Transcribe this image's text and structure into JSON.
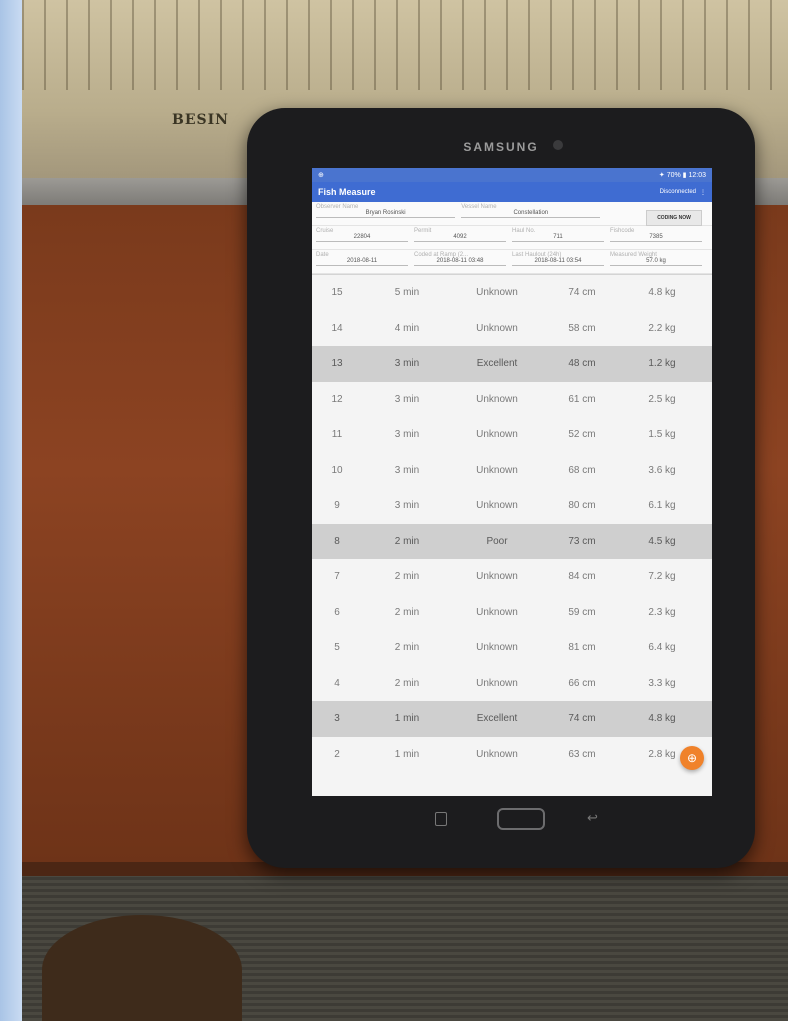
{
  "device": {
    "brand": "SAMSUNG",
    "board_logo": "BESIN"
  },
  "status_bar": {
    "left": "⊕",
    "right": "✦ 70% ▮ 12:03"
  },
  "app_bar": {
    "title": "Fish Measure",
    "button_label": "Disconnected",
    "menu_icon": "overflow-menu-icon"
  },
  "info": {
    "observer_name": {
      "label": "Observer Name",
      "value": "Bryan Rosinski"
    },
    "vessel_name": {
      "label": "Vessel Name",
      "value": "Constellation"
    },
    "coding_button": "CODING NOW",
    "cruise": {
      "label": "Cruise",
      "value": "22804"
    },
    "permit": {
      "label": "Permit",
      "value": "4092"
    },
    "haul_no": {
      "label": "Haul No.",
      "value": "711"
    },
    "fishcode": {
      "label": "Fishcode",
      "value": "7385"
    },
    "date": {
      "label": "Date",
      "value": "2018-08-11"
    },
    "coded_at_ramp": {
      "label": "Coded at Ramp (2...",
      "value": "2018-08-11 03:48"
    },
    "last_haulout": {
      "label": "Last Haulout (24h)",
      "value": "2018-08-11 03:54"
    },
    "measured_weight": {
      "label": "Measured Weight",
      "value": "57.0 kg"
    }
  },
  "rows": [
    {
      "n": "15",
      "time": "5 min",
      "quality": "Unknown",
      "length": "74 cm",
      "weight": "4.8 kg",
      "highlight": false
    },
    {
      "n": "14",
      "time": "4 min",
      "quality": "Unknown",
      "length": "58 cm",
      "weight": "2.2 kg",
      "highlight": false
    },
    {
      "n": "13",
      "time": "3 min",
      "quality": "Excellent",
      "length": "48 cm",
      "weight": "1.2 kg",
      "highlight": true
    },
    {
      "n": "12",
      "time": "3 min",
      "quality": "Unknown",
      "length": "61 cm",
      "weight": "2.5 kg",
      "highlight": false
    },
    {
      "n": "11",
      "time": "3 min",
      "quality": "Unknown",
      "length": "52 cm",
      "weight": "1.5 kg",
      "highlight": false
    },
    {
      "n": "10",
      "time": "3 min",
      "quality": "Unknown",
      "length": "68 cm",
      "weight": "3.6 kg",
      "highlight": false
    },
    {
      "n": "9",
      "time": "3 min",
      "quality": "Unknown",
      "length": "80 cm",
      "weight": "6.1 kg",
      "highlight": false
    },
    {
      "n": "8",
      "time": "2 min",
      "quality": "Poor",
      "length": "73 cm",
      "weight": "4.5 kg",
      "highlight": true
    },
    {
      "n": "7",
      "time": "2 min",
      "quality": "Unknown",
      "length": "84 cm",
      "weight": "7.2 kg",
      "highlight": false
    },
    {
      "n": "6",
      "time": "2 min",
      "quality": "Unknown",
      "length": "59 cm",
      "weight": "2.3 kg",
      "highlight": false
    },
    {
      "n": "5",
      "time": "2 min",
      "quality": "Unknown",
      "length": "81 cm",
      "weight": "6.4 kg",
      "highlight": false
    },
    {
      "n": "4",
      "time": "2 min",
      "quality": "Unknown",
      "length": "66 cm",
      "weight": "3.3 kg",
      "highlight": false
    },
    {
      "n": "3",
      "time": "1 min",
      "quality": "Excellent",
      "length": "74 cm",
      "weight": "4.8 kg",
      "highlight": true
    },
    {
      "n": "2",
      "time": "1 min",
      "quality": "Unknown",
      "length": "63 cm",
      "weight": "2.8 kg",
      "highlight": false
    }
  ],
  "fab_icon": "add-icon",
  "colors": {
    "app_bar": "#3f6cd2",
    "fab": "#f0822a",
    "highlight_row": "#cfcfcf"
  }
}
